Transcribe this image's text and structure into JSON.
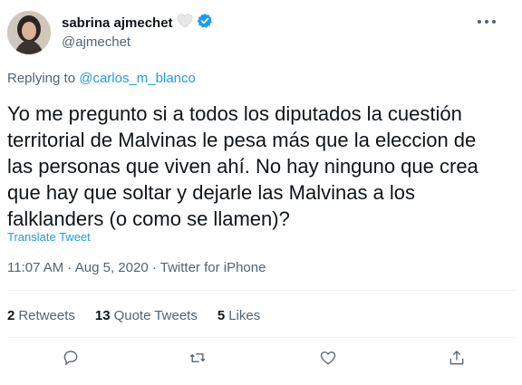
{
  "author": {
    "name": "sabrina ajmechet",
    "handle": "@ajmechet"
  },
  "reply": {
    "prefix": "Replying to",
    "to": "@carlos_m_blanco"
  },
  "tweet": {
    "text": "Yo me pregunto si a todos los diputados la cuestión\nterritorial de Malvinas le pesa más que la eleccion de\nlas personas que viven ahí. No hay ninguno que crea\nque hay que soltar y dejarle las Malvinas a los\nfalklanders (o como se llamen)?",
    "translate_label": "Translate Tweet",
    "timestamp": "11:07 AM · Aug 5, 2020 · Twitter for iPhone"
  },
  "stats": {
    "retweets_count": "2",
    "retweets_label": "Retweets",
    "quotes_count": "13",
    "quotes_label": "Quote Tweets",
    "likes_count": "5",
    "likes_label": "Likes"
  },
  "icons": {
    "verified": "verified-badge-icon",
    "heart_badge": "white-heart-emoji",
    "more": "more-icon",
    "reply": "reply-icon",
    "retweet": "retweet-icon",
    "like": "like-icon",
    "share": "share-icon"
  },
  "colors": {
    "accent": "#1d9bf0",
    "text": "#0f1419",
    "muted": "#536471"
  }
}
